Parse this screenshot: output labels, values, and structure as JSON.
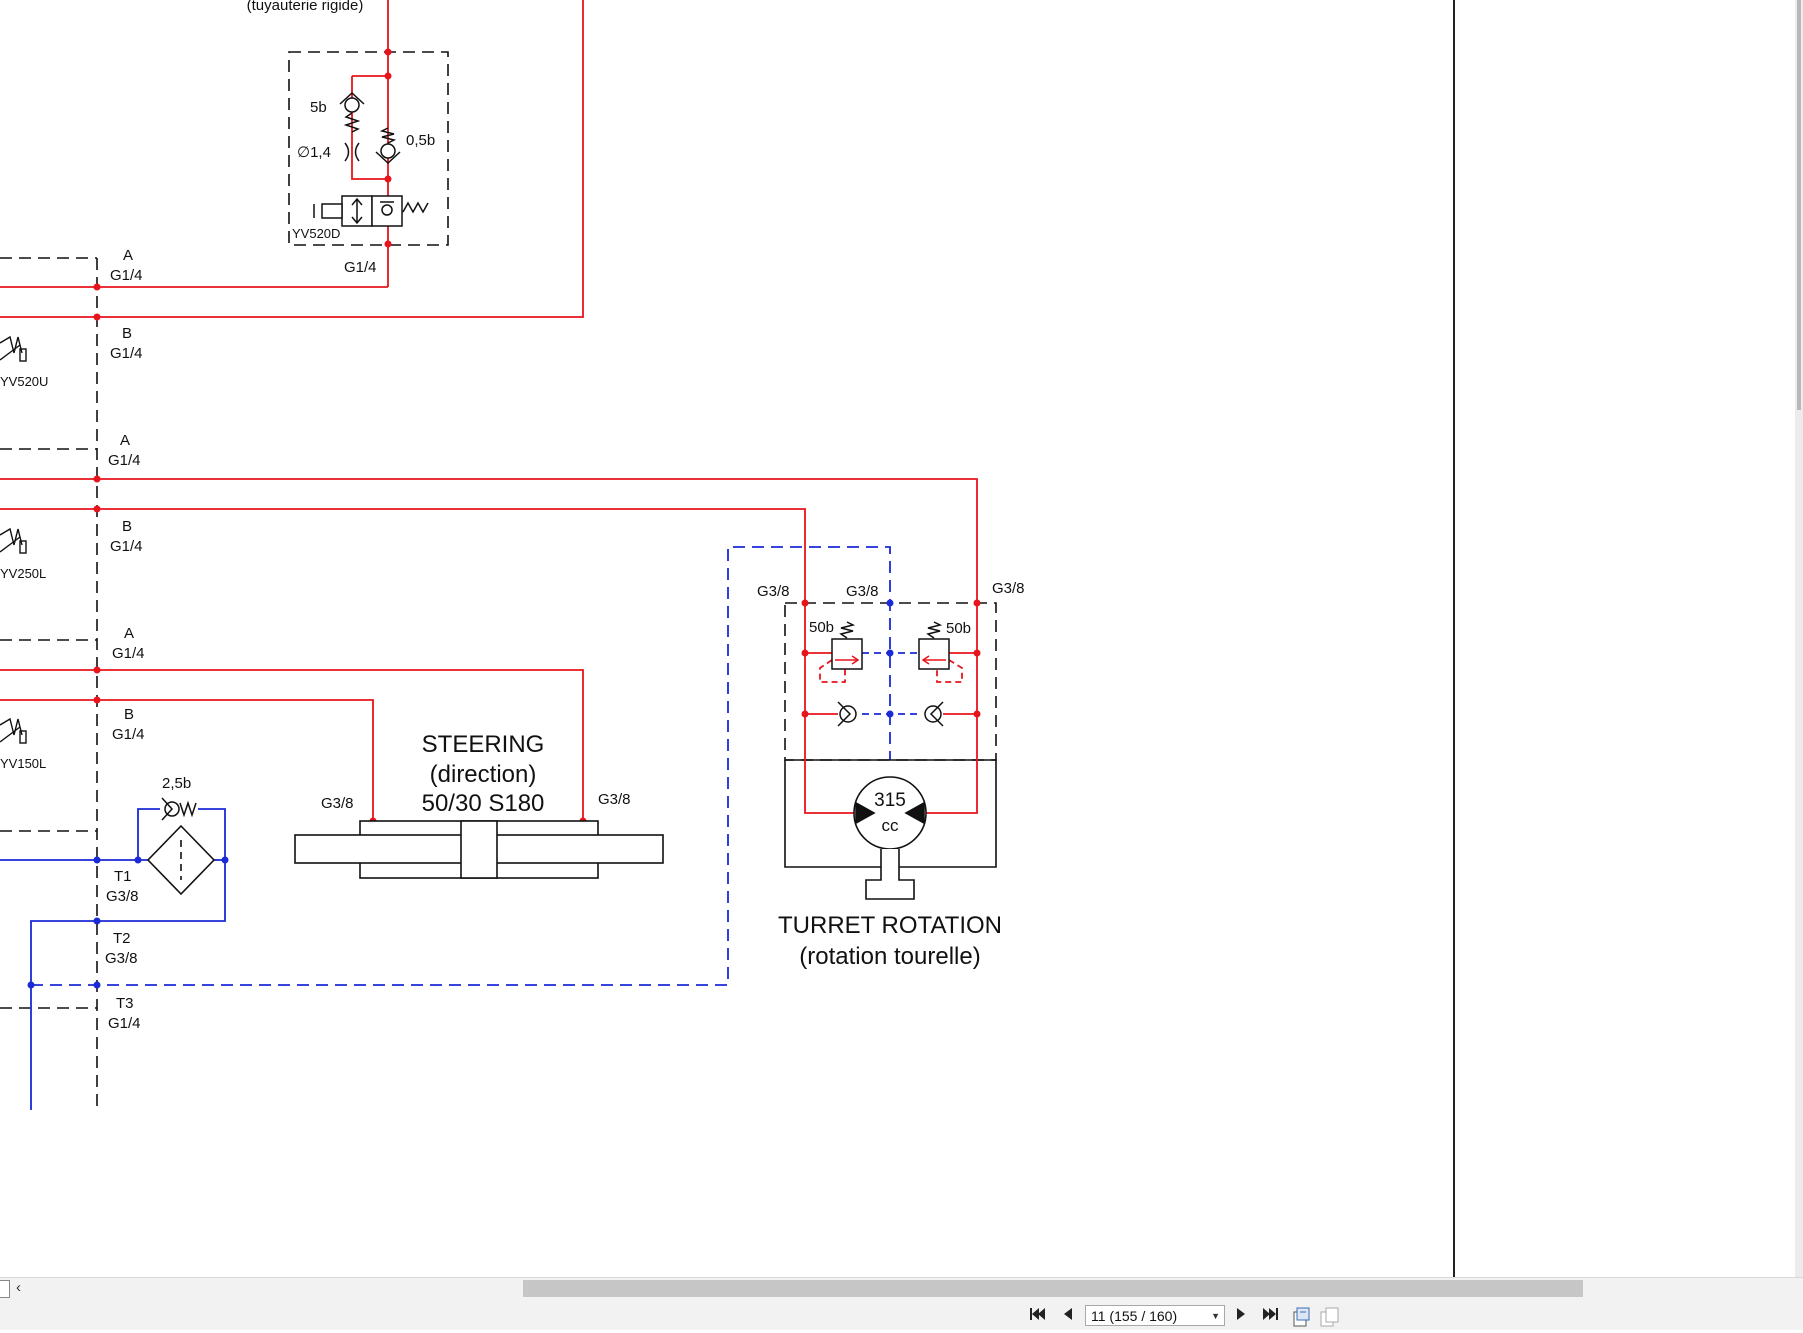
{
  "diagram": {
    "rigid_pipe_note": "(tuyauterie rigide)",
    "valve_block": {
      "check_5b": "5b",
      "orifice": "∅1,4",
      "check_05b": "0,5b",
      "solenoid": "YV520D",
      "port": "G1/4"
    },
    "ports": [
      {
        "name": "A",
        "thread": "G1/4"
      },
      {
        "name": "B",
        "thread": "G1/4"
      },
      {
        "name": "A",
        "thread": "G1/4"
      },
      {
        "name": "B",
        "thread": "G1/4"
      },
      {
        "name": "A",
        "thread": "G1/4"
      },
      {
        "name": "B",
        "thread": "G1/4"
      },
      {
        "name": "T1",
        "thread": "G3/8"
      },
      {
        "name": "T2",
        "thread": "G3/8"
      },
      {
        "name": "T3",
        "thread": "G1/4"
      }
    ],
    "solenoids": [
      "YV520U",
      "YV250L",
      "YV150L"
    ],
    "filter_check": "2,5b",
    "steering": {
      "title": "STEERING",
      "subtitle": "(direction)",
      "spec": "50/30 S180",
      "port_left": "G3/8",
      "port_right": "G3/8"
    },
    "turret": {
      "title": "TURRET ROTATION",
      "subtitle": "(rotation tourelle)",
      "port_left": "G3/8",
      "port_mid": "G3/8",
      "port_right": "G3/8",
      "relief_left": "50b",
      "relief_right": "50b",
      "motor_size": "315",
      "motor_unit": "cc"
    },
    "colors": {
      "pressure_line": "#e8141b",
      "drain_line": "#1a2ad6",
      "outline": "#111111"
    }
  },
  "statusbar": {
    "page_select_value": "11 (155 / 160)",
    "icons": [
      "first-page-icon",
      "previous-page-icon",
      "next-page-icon",
      "last-page-icon",
      "single-page-view-icon",
      "two-page-view-icon"
    ]
  }
}
